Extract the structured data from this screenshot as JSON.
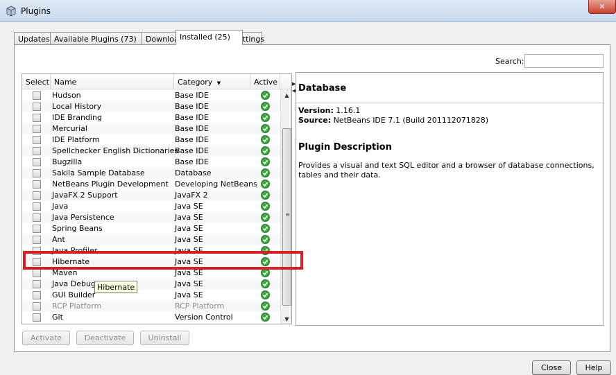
{
  "window": {
    "title": "Plugins",
    "close_glyph": "✕"
  },
  "tabs": [
    {
      "label": "Updates",
      "active": false
    },
    {
      "label": "Available Plugins (73)",
      "active": false
    },
    {
      "label": "Downloaded",
      "active": false
    },
    {
      "label": "Installed (25)",
      "active": true
    },
    {
      "label": "Settings",
      "active": false
    }
  ],
  "search": {
    "label": "Search:",
    "value": ""
  },
  "table": {
    "headers": {
      "select": "Select",
      "name": "Name",
      "category": "Category",
      "active": "Active"
    },
    "sort_indicator": "▼",
    "rows": [
      {
        "name": "Hudson",
        "category": "Base IDE",
        "dim": false
      },
      {
        "name": "Local History",
        "category": "Base IDE",
        "dim": false
      },
      {
        "name": "IDE Branding",
        "category": "Base IDE",
        "dim": false
      },
      {
        "name": "Mercurial",
        "category": "Base IDE",
        "dim": false
      },
      {
        "name": "IDE Platform",
        "category": "Base IDE",
        "dim": false
      },
      {
        "name": "Spellchecker English Dictionaries",
        "category": "Base IDE",
        "dim": false
      },
      {
        "name": "Bugzilla",
        "category": "Base IDE",
        "dim": false
      },
      {
        "name": "Sakila Sample Database",
        "category": "Database",
        "dim": false
      },
      {
        "name": "NetBeans Plugin Development",
        "category": "Developing NetBeans",
        "dim": false
      },
      {
        "name": "JavaFX 2 Support",
        "category": "JavaFX 2",
        "dim": false
      },
      {
        "name": "Java",
        "category": "Java SE",
        "dim": false
      },
      {
        "name": "Java Persistence",
        "category": "Java SE",
        "dim": false
      },
      {
        "name": "Spring Beans",
        "category": "Java SE",
        "dim": false
      },
      {
        "name": "Ant",
        "category": "Java SE",
        "dim": false
      },
      {
        "name": "Java Profiler",
        "category": "Java SE",
        "dim": false
      },
      {
        "name": "Hibernate",
        "category": "Java SE",
        "dim": false
      },
      {
        "name": "Maven",
        "category": "Java SE",
        "dim": false
      },
      {
        "name": "Java Debugger",
        "category": "Java SE",
        "dim": false
      },
      {
        "name": "GUI Builder",
        "category": "Java SE",
        "dim": false
      },
      {
        "name": "RCP Platform",
        "category": "RCP Platform",
        "dim": true
      },
      {
        "name": "Git",
        "category": "Version Control",
        "dim": false
      }
    ]
  },
  "tooltip": {
    "text": "Hibernate"
  },
  "detail": {
    "title": "Database",
    "version_label": "Version:",
    "version_value": "1.16.1",
    "source_label": "Source:",
    "source_value": "NetBeans IDE 7.1 (Build 201112071828)",
    "description_title": "Plugin Description",
    "description": "Provides a visual and text SQL editor and a browser of database connections, tables and their data."
  },
  "buttons": {
    "activate": "Activate",
    "deactivate": "Deactivate",
    "uninstall": "Uninstall",
    "close": "Close",
    "help": "Help"
  },
  "colors": {
    "highlight": "#d42027",
    "check_green": "#3ea63e"
  }
}
